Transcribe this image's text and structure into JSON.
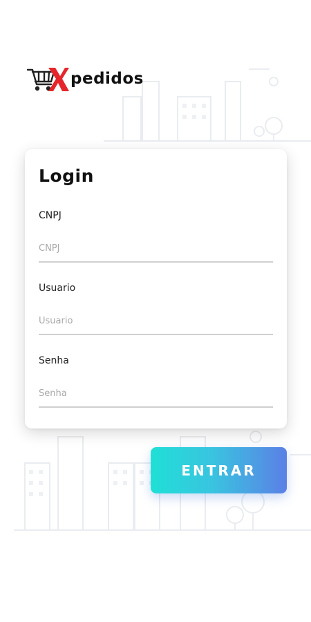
{
  "brand": {
    "name": "pedidos",
    "logo_letter": "X",
    "accent": "#e5252b"
  },
  "login": {
    "title": "Login",
    "fields": [
      {
        "label": "CNPJ",
        "placeholder": "CNPJ",
        "value": ""
      },
      {
        "label": "Usuario",
        "placeholder": "Usuario",
        "value": ""
      },
      {
        "label": "Senha",
        "placeholder": "Senha",
        "value": ""
      }
    ],
    "submit_label": "ENTRAR"
  },
  "colors": {
    "button_gradient_start": "#1fe0d6",
    "button_gradient_end": "#5b80e6",
    "input_underline": "#cfcfcf"
  },
  "icons": [
    "shopping-cart-icon"
  ]
}
